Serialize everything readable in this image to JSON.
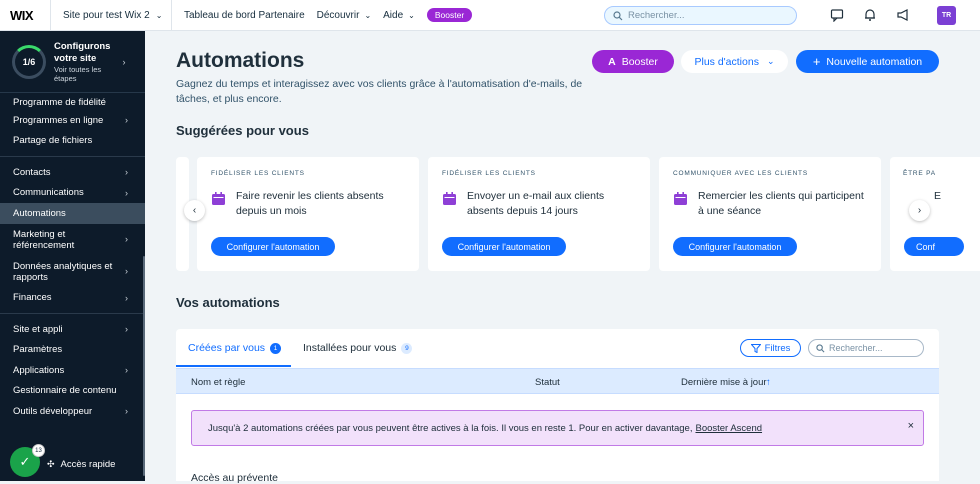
{
  "topbar": {
    "logo": "WIX",
    "site_name": "Site pour test Wix 2",
    "nav": [
      "Tableau de bord Partenaire",
      "Découvrir",
      "Aide"
    ],
    "booster": "Booster",
    "search_placeholder": "Rechercher...",
    "avatar_initials": "TR"
  },
  "sidebar": {
    "setup_progress": "1/6",
    "setup_title_1": "Configurons",
    "setup_title_2": "votre site",
    "setup_sub_1": "Voir toutes les",
    "setup_sub_2": "étapes",
    "items": [
      {
        "label": "Programme de fidélité",
        "chevron": false
      },
      {
        "label": "Programmes en ligne",
        "chevron": true
      },
      {
        "label": "Partage de fichiers",
        "chevron": false
      },
      {
        "label": "Contacts",
        "chevron": true
      },
      {
        "label": "Communications",
        "chevron": true
      },
      {
        "label": "Automations",
        "chevron": false
      },
      {
        "label": "Marketing et référencement",
        "chevron": true
      },
      {
        "label": "Données analytiques et rapports",
        "chevron": true
      },
      {
        "label": "Finances",
        "chevron": true
      },
      {
        "label": "Site et appli",
        "chevron": true
      },
      {
        "label": "Paramètres",
        "chevron": false
      },
      {
        "label": "Applications",
        "chevron": true
      },
      {
        "label": "Gestionnaire de contenu",
        "chevron": false
      },
      {
        "label": "Outils développeur",
        "chevron": true
      }
    ],
    "quick_access": "Accès rapide",
    "quick_badge": "13"
  },
  "header": {
    "title": "Automations",
    "subtitle": "Gagnez du temps et interagissez avec vos clients grâce à l'automatisation d'e-mails, de tâches, et plus encore.",
    "booster_btn": "Booster",
    "more_btn": "Plus d'actions",
    "new_btn": "Nouvelle automation"
  },
  "suggested": {
    "heading": "Suggérées pour vous",
    "cards": [
      {
        "category": "FIDÉLISER LES CLIENTS",
        "text": "Faire revenir les clients absents depuis un mois",
        "button": "Configurer l'automation"
      },
      {
        "category": "FIDÉLISER LES CLIENTS",
        "text": "Envoyer un e-mail aux clients absents depuis 14 jours",
        "button": "Configurer l'automation"
      },
      {
        "category": "COMMUNIQUER AVEC LES CLIENTS",
        "text": "Remercier les clients qui participent à une séance",
        "button": "Configurer l'automation"
      },
      {
        "category": "ÊTRE PA",
        "text": "E",
        "button": "Conf"
      }
    ]
  },
  "yours": {
    "heading": "Vos automations",
    "tabs": [
      {
        "label": "Créées par vous",
        "count": "1"
      },
      {
        "label": "Installées pour vous",
        "count": "9"
      }
    ],
    "filters_btn": "Filtres",
    "search_placeholder": "Rechercher...",
    "columns": [
      "Nom et règle",
      "Statut",
      "Dernière mise à jour"
    ],
    "notice": "Jusqu'à 2 automations créées par vous peuvent être actives à la fois. Il vous en reste 1. Pour en activer davantage,",
    "notice_link": "Booster Ascend",
    "first_row": "Accès au prévente"
  },
  "colors": {
    "accent": "#116dff",
    "booster": "#9a27d5",
    "sidebar": "#0d1b2a"
  }
}
